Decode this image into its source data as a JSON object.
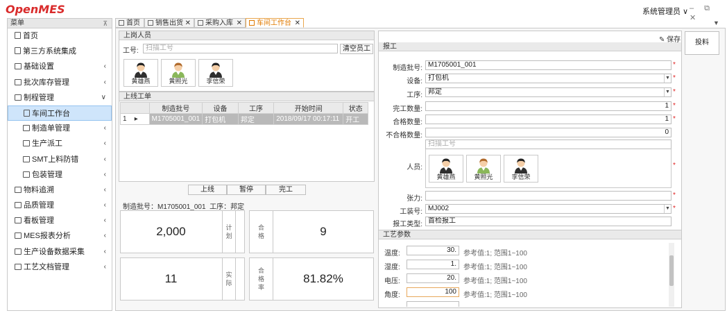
{
  "app": {
    "logo": "OpenMES",
    "user": "系统管理员 ∨",
    "window_controls": "– ⧉ ✕"
  },
  "sidebar": {
    "title": "菜单",
    "items": [
      {
        "label": "首页",
        "icon": "document-icon"
      },
      {
        "label": "第三方系统集成",
        "icon": "document-icon"
      },
      {
        "label": "基础设置",
        "icon": "folder-icon",
        "arrow": "‹"
      },
      {
        "label": "批次库存管理",
        "icon": "folder-icon",
        "arrow": "‹"
      },
      {
        "label": "制程管理",
        "icon": "folder-icon",
        "arrow": "∨"
      },
      {
        "label": "车间工作台",
        "icon": "document-icon",
        "active": true
      },
      {
        "label": "制造单管理",
        "icon": "folder-icon",
        "arrow": "‹"
      },
      {
        "label": "生产派工",
        "icon": "folder-icon",
        "arrow": "‹"
      },
      {
        "label": "SMT上料防错",
        "icon": "folder-icon",
        "arrow": "‹"
      },
      {
        "label": "包装管理",
        "icon": "folder-icon",
        "arrow": "‹"
      },
      {
        "label": "物料追溯",
        "icon": "folder-icon",
        "arrow": "‹"
      },
      {
        "label": "品质管理",
        "icon": "folder-icon",
        "arrow": "‹"
      },
      {
        "label": "看板管理",
        "icon": "folder-icon",
        "arrow": "‹"
      },
      {
        "label": "MES报表分析",
        "icon": "folder-icon",
        "arrow": "‹"
      },
      {
        "label": "生产设备数据采集",
        "icon": "folder-icon",
        "arrow": "‹"
      },
      {
        "label": "工艺文档管理",
        "icon": "folder-icon",
        "arrow": "‹"
      }
    ]
  },
  "tabs": [
    {
      "label": "首页",
      "closable": false
    },
    {
      "label": "销售出货",
      "closable": true
    },
    {
      "label": "采购入库",
      "closable": true
    },
    {
      "label": "车间工作台",
      "closable": true,
      "active": true
    }
  ],
  "onduty": {
    "title": "上岗人员",
    "worker_label": "工号:",
    "worker_placeholder": "扫描工号",
    "clear_button": "清空员工",
    "people": [
      "黄雄燕",
      "黄照光",
      "李信荣"
    ]
  },
  "online": {
    "title": "上线工单",
    "columns": [
      "制造批号",
      "设备",
      "工序",
      "开始时间",
      "状态"
    ],
    "rows": [
      {
        "row": "1",
        "marker": "▸",
        "batch": "M1705001_001",
        "device": "打包机",
        "process": "邦定",
        "start": "2018/09/17 00:17:11",
        "status": "开工"
      }
    ],
    "buttons": [
      "上线",
      "暂停",
      "完工"
    ]
  },
  "summary": {
    "batch_label": "制造批号：",
    "batch_value": "M1705001_001",
    "process_label": "工序：",
    "process_value": "邦定"
  },
  "stats": {
    "plan": {
      "value": "2,000",
      "label_1": "计",
      "label_2": "划"
    },
    "pass": {
      "value": "9",
      "label_1": "合",
      "label_2": "格"
    },
    "actual": {
      "value": "11",
      "label_1": "实",
      "label_2": "际"
    },
    "rate": {
      "value": "81.82%",
      "label_1": "合",
      "label_2": "格",
      "label_3": "率"
    }
  },
  "report": {
    "save_button": "保存",
    "title": "报工",
    "batch_label": "制造批号:",
    "batch_value": "M1705001_001",
    "device_label": "设备:",
    "device_value": "打包机",
    "process_label": "工序:",
    "process_value": "邦定",
    "done_label": "完工数量:",
    "done_value": "1",
    "pass_label": "合格数量:",
    "pass_value": "1",
    "fail_label": "不合格数量:",
    "fail_value": "0",
    "people_label": "人员:",
    "people_placeholder": "扫描工号",
    "people": [
      "黄雄燕",
      "黄照光",
      "李信荣"
    ],
    "tension_label": "张力:",
    "tension_value": "",
    "mold_label": "工装号:",
    "mold_value": "MJ002",
    "type_label": "报工类型:",
    "type_value": "首检报工",
    "required_mark": "*"
  },
  "params": {
    "title": "工艺参数",
    "items": [
      {
        "label": "温度:",
        "value": "30.",
        "ref": "参考值:1; 范围1~100"
      },
      {
        "label": "湿度:",
        "value": "1.",
        "ref": "参考值:1; 范围1~100"
      },
      {
        "label": "电压:",
        "value": "20.",
        "ref": "参考值:1; 范围1~100"
      },
      {
        "label": "角度:",
        "value": "100",
        "ref": "参考值:1; 范围1~100",
        "focus": true
      }
    ]
  },
  "feed_button": "投料",
  "colors": {
    "logo": "#d92b2b",
    "active_tab": "#e07a00",
    "required": "#e02424",
    "selection": "#cfe5fb"
  }
}
